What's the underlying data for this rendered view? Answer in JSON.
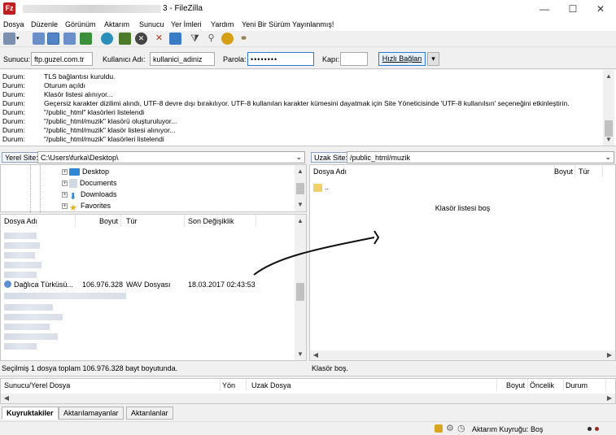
{
  "window": {
    "title": "3 - FileZilla",
    "minimize": "—",
    "maximize": "☐",
    "close": "✕"
  },
  "menu": [
    "Dosya",
    "Düzenle",
    "Görünüm",
    "Aktarım",
    "Sunucu",
    "Yer İmleri",
    "Yardım",
    "Yeni Bir Sürüm Yayınlanmış!"
  ],
  "quickconnect": {
    "host_label": "Sunucu:",
    "host_value": "ftp.guzel.com.tr",
    "user_label": "Kullanıcı Adı:",
    "user_value": "kullanici_adiniz",
    "pass_label": "Parola:",
    "pass_value": "••••••••",
    "port_label": "Kapı:",
    "port_value": "",
    "connect_label": "Hızlı Bağlan",
    "dropdown": "▾"
  },
  "log": [
    {
      "k": "Durum:",
      "v": "TLS bağlantısı kuruldu."
    },
    {
      "k": "Durum:",
      "v": "Oturum açıldı"
    },
    {
      "k": "Durum:",
      "v": "Klasör listesi alınıyor..."
    },
    {
      "k": "Durum:",
      "v": "Geçersiz karakter dizilimi alındı, UTF-8 devre dışı bırakılıyor. UTF-8 kullanılan karakter kümesini dayatmak için Site Yöneticisinde 'UTF-8 kullanılsın' seçeneğini etkinleştirin."
    },
    {
      "k": "Durum:",
      "v": "\"/public_html\" klasörleri listelendi"
    },
    {
      "k": "Durum:",
      "v": "\"/public_html/muzik\" klasörü oluşturuluyor..."
    },
    {
      "k": "Durum:",
      "v": "\"/public_html/muzik\" klasör listesi alınıyor..."
    },
    {
      "k": "Durum:",
      "v": "\"/public_html/muzik\" klasörleri listelendi"
    }
  ],
  "local": {
    "site_label": "Yerel Site:",
    "path": "C:\\Users\\furka\\Desktop\\",
    "tree": [
      "Desktop",
      "Documents",
      "Downloads",
      "Favorites"
    ],
    "columns": [
      "Dosya Adı",
      "Boyut",
      "Tür",
      "Son Değişiklik"
    ],
    "selected_file": {
      "name": "Dağlıca Türküsü...",
      "size": "106.976.328",
      "type": "WAV Dosyası",
      "modified": "18.03.2017 02:43:53"
    },
    "status": "Seçilmiş 1 dosya toplam 106.976.328 bayt boyutunda."
  },
  "remote": {
    "site_label": "Uzak Site:",
    "path": "/public_html/muzik",
    "columns": [
      "Dosya Adı",
      "Boyut",
      "Tür"
    ],
    "parent_item": "..",
    "empty_text": "Klasör listesi boş",
    "status": "Klasör boş."
  },
  "queue": {
    "columns": [
      "Sunucu/Yerel Dosya",
      "Yön",
      "Uzak Dosya",
      "Boyut",
      "Öncelik",
      "Durum"
    ],
    "tabs": [
      "Kuyruktakiler",
      "Aktarılamayanlar",
      "Aktarılanlar"
    ],
    "status": "Aktarım Kuyruğu: Boş"
  },
  "colors": {
    "accent": "#2f7ad1",
    "app_red": "#bf1e1e"
  }
}
